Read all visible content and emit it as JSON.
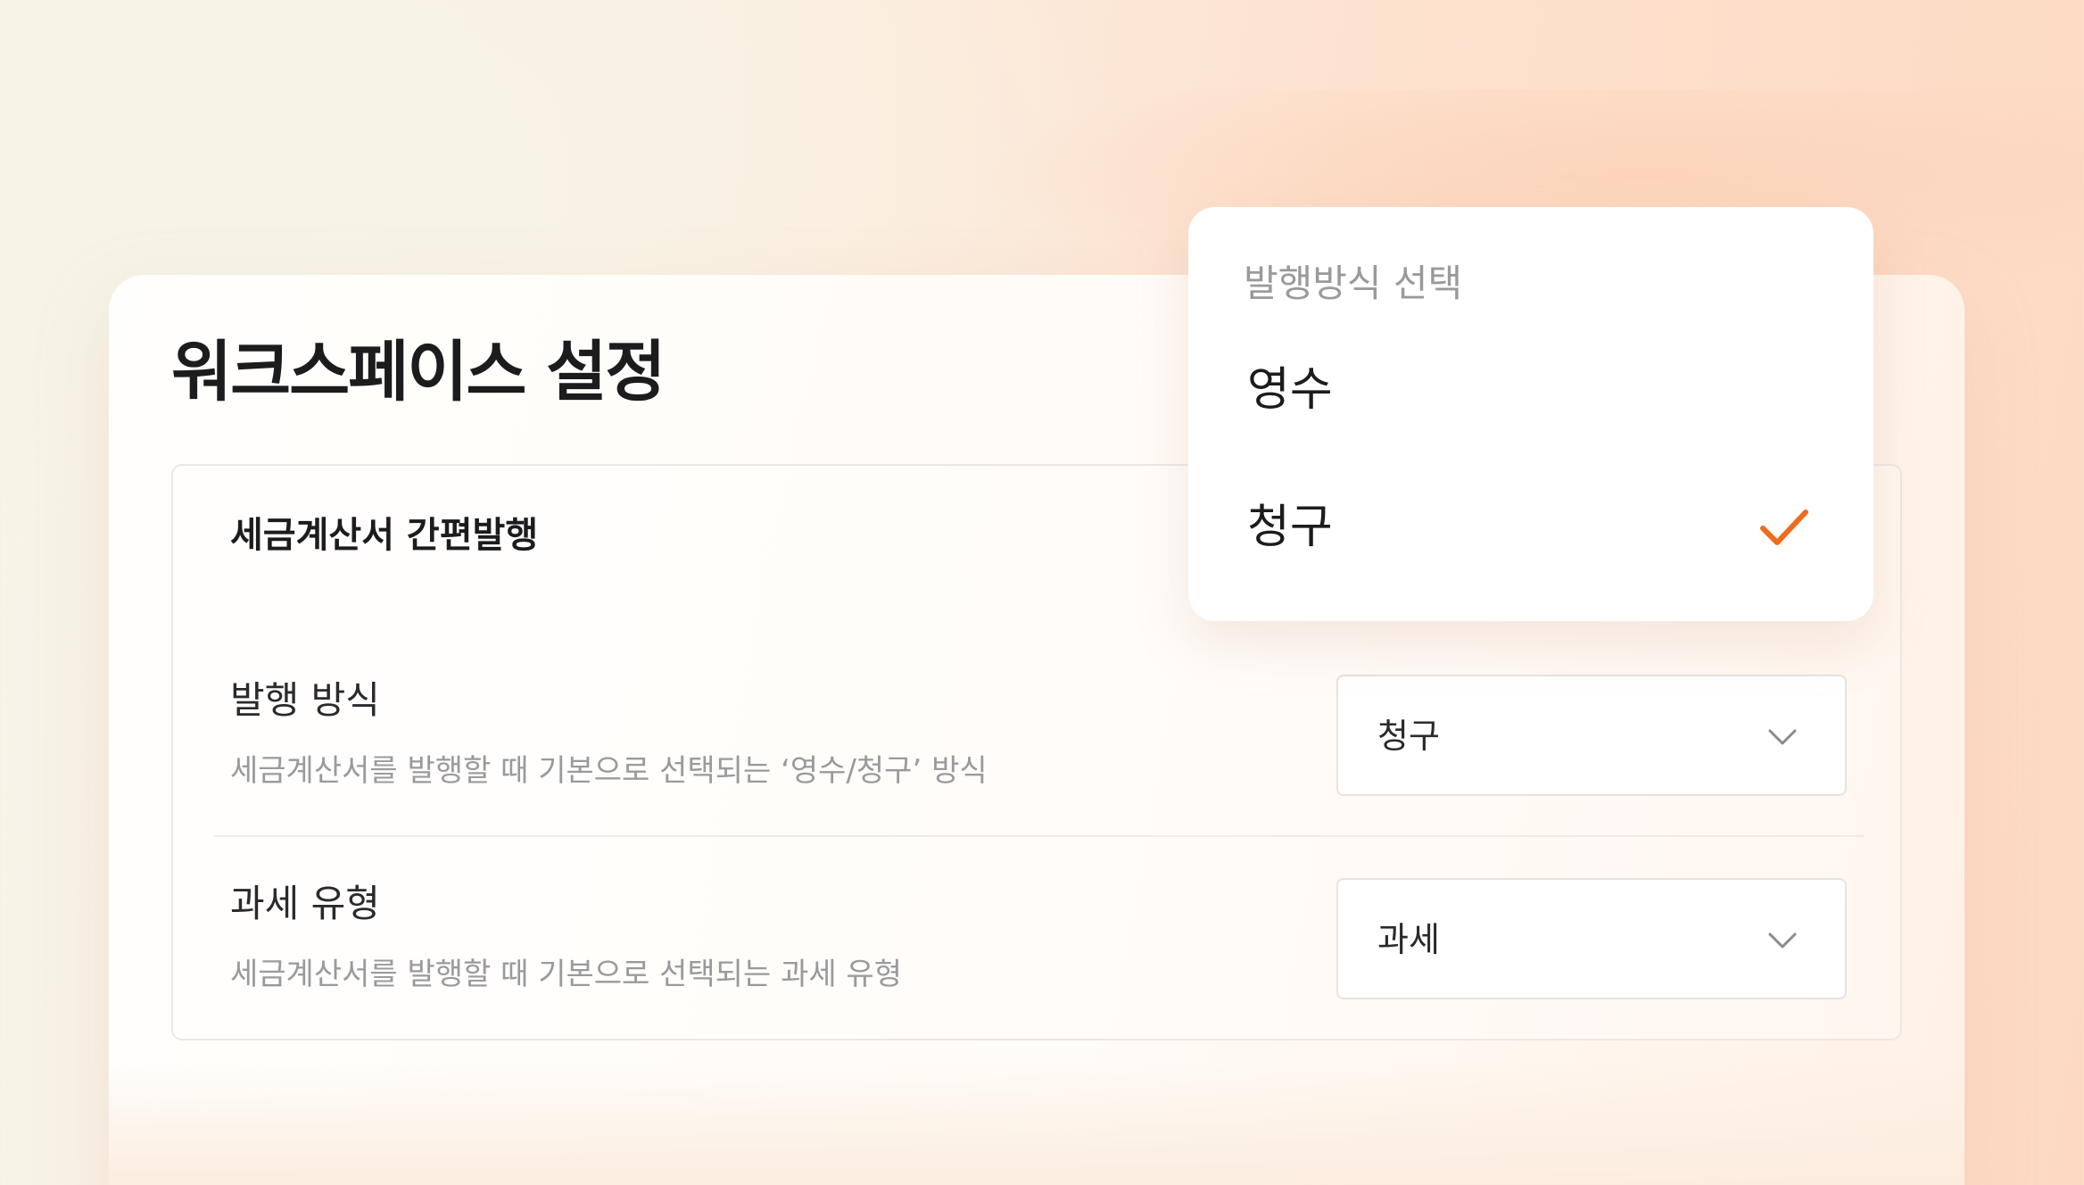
{
  "page_title": "워크스페이스 설정",
  "section": {
    "title": "세금계산서 간편발행",
    "rows": [
      {
        "label": "발행 방식",
        "description": "세금계산서를 발행할 때 기본으로 선택되는 ‘영수/청구’ 방식",
        "selected_value": "청구"
      },
      {
        "label": "과세 유형",
        "description": "세금계산서를 발행할 때 기본으로 선택되는 과세 유형",
        "selected_value": "과세"
      }
    ]
  },
  "dropdown": {
    "title": "발행방식 선택",
    "options": [
      {
        "label": "영수",
        "selected": false
      },
      {
        "label": "청구",
        "selected": true
      }
    ]
  },
  "colors": {
    "accent": "#f26a1b",
    "text_primary": "#1c1c1e",
    "text_secondary": "#9a9a9c"
  },
  "icons": {
    "chevron": "chevron-down-icon",
    "check": "check-icon"
  }
}
